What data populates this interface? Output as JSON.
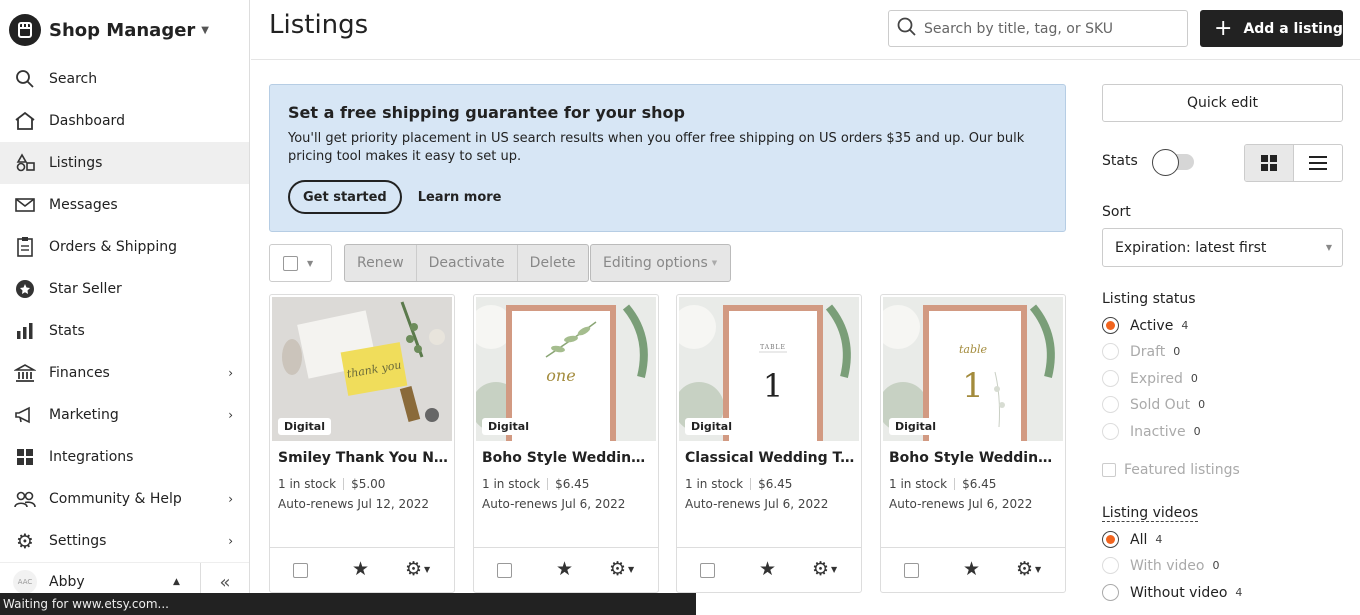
{
  "app": {
    "title": "Shop Manager"
  },
  "sidebar": {
    "items": [
      {
        "label": "Search"
      },
      {
        "label": "Dashboard"
      },
      {
        "label": "Listings"
      },
      {
        "label": "Messages"
      },
      {
        "label": "Orders & Shipping"
      },
      {
        "label": "Star Seller"
      },
      {
        "label": "Stats"
      },
      {
        "label": "Finances"
      },
      {
        "label": "Marketing"
      },
      {
        "label": "Integrations"
      },
      {
        "label": "Community & Help"
      },
      {
        "label": "Settings"
      }
    ],
    "active_item": "Listings",
    "user": {
      "name": "Abby",
      "avatar_text": "AAC"
    }
  },
  "header": {
    "title": "Listings",
    "search_placeholder": "Search by title, tag, or SKU",
    "add_button": "Add a listing"
  },
  "banner": {
    "title": "Set a free shipping guarantee for your shop",
    "text": "You'll get priority placement in US search results when you offer free shipping on US orders $35 and up. Our bulk pricing tool makes it easy to set up.",
    "primary": "Get started",
    "secondary": "Learn more"
  },
  "bulk": {
    "renew": "Renew",
    "deactivate": "Deactivate",
    "delete": "Delete",
    "editing": "Editing options"
  },
  "listings": [
    {
      "title": "Smiley Thank You Note ...",
      "badge": "Digital",
      "stock": "1 in stock",
      "price": "$5.00",
      "renew": "Auto-renews Jul 12, 2022",
      "img_text": "thank you"
    },
    {
      "title": "Boho Style Wedding Ta...",
      "badge": "Digital",
      "stock": "1 in stock",
      "price": "$6.45",
      "renew": "Auto-renews Jul 6, 2022",
      "img_text": "one"
    },
    {
      "title": "Classical Wedding Tabl...",
      "badge": "Digital",
      "stock": "1 in stock",
      "price": "$6.45",
      "renew": "Auto-renews Jul 6, 2022",
      "img_text": "1",
      "img_subtext": "TABLE"
    },
    {
      "title": "Boho Style Wedding Ta...",
      "badge": "Digital",
      "stock": "1 in stock",
      "price": "$6.45",
      "renew": "Auto-renews Jul 6, 2022",
      "img_text": "1",
      "img_subtext": "table"
    }
  ],
  "panel": {
    "quick_edit": "Quick edit",
    "stats_label": "Stats",
    "stats_on": false,
    "view": "grid",
    "sort_label": "Sort",
    "sort_value": "Expiration: latest first",
    "status_label": "Listing status",
    "statuses": [
      {
        "label": "Active",
        "count": "4",
        "checked": true
      },
      {
        "label": "Draft",
        "count": "0"
      },
      {
        "label": "Expired",
        "count": "0"
      },
      {
        "label": "Sold Out",
        "count": "0"
      },
      {
        "label": "Inactive",
        "count": "0"
      }
    ],
    "featured": "Featured listings",
    "videos_label": "Listing videos",
    "videos": [
      {
        "label": "All",
        "count": "4",
        "checked": true
      },
      {
        "label": "With video",
        "count": "0"
      },
      {
        "label": "Without video",
        "count": "4"
      }
    ]
  },
  "statusbar": {
    "text": "Waiting for www.etsy.com..."
  },
  "colors": {
    "accent": "#f1641e",
    "banner_bg": "#d7e6f5",
    "dark": "#222222"
  }
}
